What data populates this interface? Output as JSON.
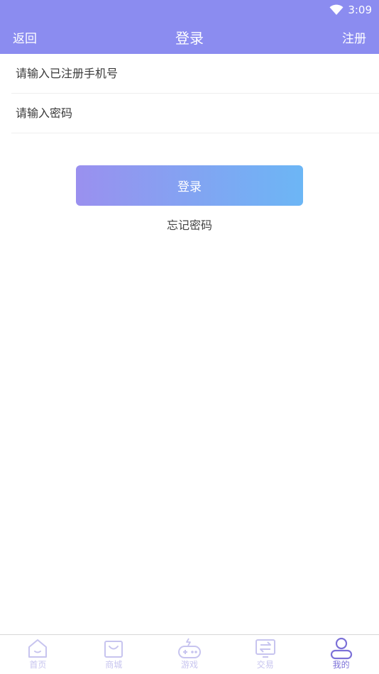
{
  "status_bar": {
    "time": "3:09"
  },
  "nav": {
    "back_label": "返回",
    "title": "登录",
    "register_label": "注册"
  },
  "form": {
    "phone_placeholder": "请输入已注册手机号",
    "password_placeholder": "请输入密码",
    "login_label": "登录",
    "forgot_label": "忘记密码"
  },
  "tabs": [
    {
      "label": "首页",
      "icon": "home-icon"
    },
    {
      "label": "商城",
      "icon": "shop-bag-icon"
    },
    {
      "label": "游戏",
      "icon": "gamepad-icon"
    },
    {
      "label": "交易",
      "icon": "exchange-icon"
    },
    {
      "label": "我的",
      "icon": "user-icon",
      "active": true
    }
  ],
  "colors": {
    "header": "#8b8cf0",
    "button_start": "#9a90ef",
    "button_end": "#6cb6f5",
    "tab_inactive": "#c7c4ef",
    "tab_active": "#7c71d8"
  }
}
